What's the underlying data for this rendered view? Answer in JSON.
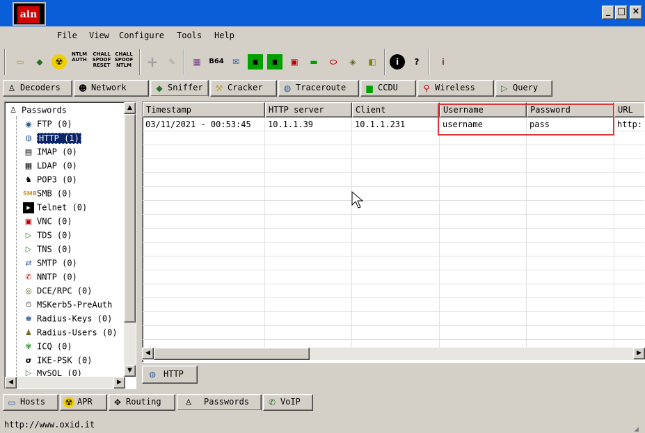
{
  "app": {
    "logo_text": "ain",
    "window_buttons": {
      "minimize": "_",
      "maximize": "□",
      "close": "×"
    }
  },
  "menu": [
    {
      "key": "file",
      "label": "File"
    },
    {
      "key": "view",
      "label": "View"
    },
    {
      "key": "configure",
      "label": "Configure"
    },
    {
      "key": "tools",
      "label": "Tools"
    },
    {
      "key": "help",
      "label": "Help"
    }
  ],
  "toolbar": {
    "ntlm_auth": "NTLM AUTH",
    "spoof_reset": "CHALL SPOOF RESET",
    "spoof_ntlm": "CHALL SPOOF NTLM",
    "base64": "B64"
  },
  "tabs_top": [
    {
      "key": "decoders",
      "label": "Decoders"
    },
    {
      "key": "network",
      "label": "Network"
    },
    {
      "key": "sniffer",
      "label": "Sniffer"
    },
    {
      "key": "cracker",
      "label": "Cracker"
    },
    {
      "key": "traceroute",
      "label": "Traceroute"
    },
    {
      "key": "ccdu",
      "label": "CCDU"
    },
    {
      "key": "wireless",
      "label": "Wireless"
    },
    {
      "key": "query",
      "label": "Query"
    }
  ],
  "tree": {
    "root": "Passwords",
    "items": [
      {
        "key": "ftp",
        "label": "FTP  (0)"
      },
      {
        "key": "http",
        "label": "HTTP  (1)"
      },
      {
        "key": "imap",
        "label": "IMAP  (0)"
      },
      {
        "key": "ldap",
        "label": "LDAP  (0)"
      },
      {
        "key": "pop3",
        "label": "POP3  (0)"
      },
      {
        "key": "smb",
        "label": "SMB  (0)"
      },
      {
        "key": "telnet",
        "label": "Telnet  (0)"
      },
      {
        "key": "vnc",
        "label": "VNC  (0)"
      },
      {
        "key": "tds",
        "label": "TDS  (0)"
      },
      {
        "key": "tns",
        "label": "TNS  (0)"
      },
      {
        "key": "smtp",
        "label": "SMTP  (0)"
      },
      {
        "key": "nntp",
        "label": "NNTP  (0)"
      },
      {
        "key": "dcerpc",
        "label": "DCE/RPC  (0)"
      },
      {
        "key": "mskerb",
        "label": "MSKerb5-PreAuth"
      },
      {
        "key": "radius_keys",
        "label": "Radius-Keys  (0)"
      },
      {
        "key": "radius_users",
        "label": "Radius-Users  (0)"
      },
      {
        "key": "icq",
        "label": "ICQ  (0)"
      },
      {
        "key": "ikepsk",
        "label": "IKE-PSK  (0)"
      },
      {
        "key": "mysql",
        "label": "MySQL  (0)"
      }
    ]
  },
  "table": {
    "columns": [
      "Timestamp",
      "HTTP server",
      "Client",
      "Username",
      "Password",
      "URL"
    ],
    "rows": [
      [
        "03/11/2021 - 00:53:45",
        "10.1.1.39",
        "10.1.1.231",
        "username",
        "pass",
        "http:"
      ]
    ]
  },
  "inner_tab": "HTTP",
  "tabs_bottom": [
    {
      "key": "hosts",
      "label": "Hosts"
    },
    {
      "key": "apr",
      "label": "APR"
    },
    {
      "key": "routing",
      "label": "Routing"
    },
    {
      "key": "passwords",
      "label": "Passwords"
    },
    {
      "key": "voip",
      "label": "VoIP"
    }
  ],
  "status": "http://www.oxid.it",
  "colors": {
    "titlebar": "#0a5fd8",
    "highlight_box": "#d83a3a",
    "selection": "#0a246a"
  }
}
